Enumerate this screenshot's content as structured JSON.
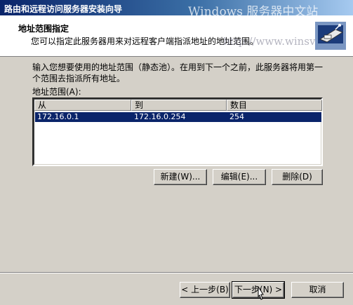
{
  "window": {
    "title": "路由和远程访问服务器安装向导",
    "watermark": "Windows 服务器中文站"
  },
  "header": {
    "heading": "地址范围指定",
    "subheading": "您可以指定此服务器用来对远程客户端指派地址的地址范围。",
    "watermark_url": "http://www.winsvr.org",
    "icon": "network-wizard-icon"
  },
  "body": {
    "description": "输入您想要使用的地址范围（静态池）。在用到下一个之前，此服务器将用第一个范围去指派所有地址。",
    "list_label": "地址范围(A):",
    "columns": [
      "从",
      "到",
      "数目"
    ],
    "rows": [
      {
        "from": "172.16.0.1",
        "to": "172.16.0.254",
        "count": "254",
        "selected": true
      }
    ]
  },
  "buttons": {
    "new": "新建(W)...",
    "edit": "编辑(E)...",
    "delete": "删除(D)",
    "back": "< 上一步(B)",
    "next": "下一步(N) >",
    "cancel": "取消"
  },
  "colors": {
    "title_start": "#0a246a",
    "title_end": "#a6caf0",
    "selection": "#0a246a",
    "face": "#d4d0c8"
  }
}
